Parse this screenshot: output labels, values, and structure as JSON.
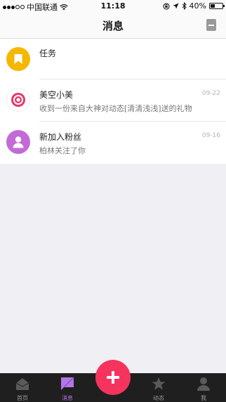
{
  "status_bar": {
    "carrier": "中国联通",
    "time": "11:18",
    "battery": "40%",
    "battery_level": 0.4
  },
  "nav": {
    "title": "消息",
    "right_icon": "book-icon"
  },
  "messages": [
    {
      "icon": "bookmark-icon",
      "name": "任务",
      "preview": "",
      "date": ""
    },
    {
      "icon": "target-icon",
      "name": "美空小美",
      "preview": "收到一份来自大神对动态[清清浅浅]送的礼物",
      "date": "09-22"
    },
    {
      "icon": "person-icon",
      "name": "新加入粉丝",
      "preview": "柏林关注了你",
      "date": "09-16"
    }
  ],
  "tabs": [
    {
      "icon": "home-icon",
      "label": "首页"
    },
    {
      "icon": "message-icon",
      "label": "消息"
    },
    {
      "icon": "star-icon",
      "label": "动态"
    },
    {
      "icon": "profile-icon",
      "label": "我"
    }
  ],
  "active_tab": "消息",
  "colors": {
    "accent": "#f5345e",
    "active_tab": "#b477e6",
    "task_avatar": "#f5b800",
    "fan_avatar": "#c26ad7"
  }
}
